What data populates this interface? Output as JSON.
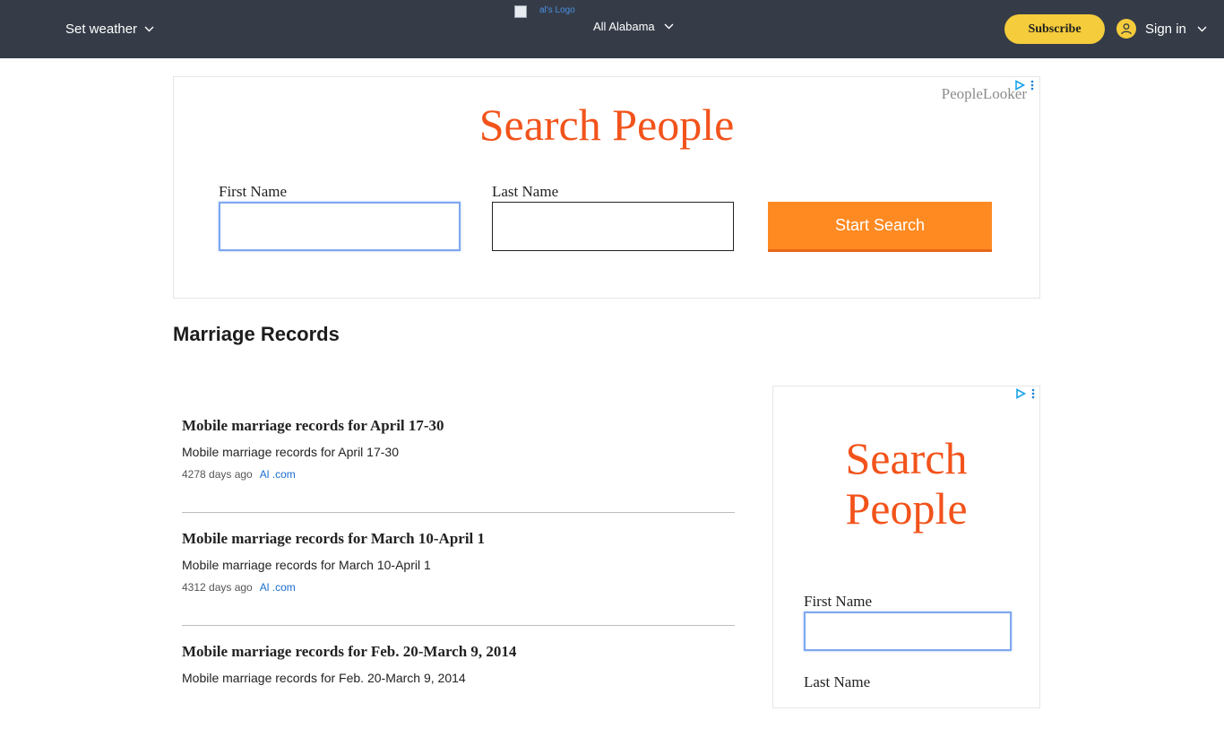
{
  "header": {
    "weather_label": "Set weather",
    "logo_alt": "al's Logo",
    "edition_label": "All Alabama",
    "subscribe_label": "Subscribe",
    "signin_label": "Sign in"
  },
  "ad_top": {
    "brand": "PeopleLooker",
    "title": "Search People",
    "first_name_label": "First Name",
    "first_name_value": "",
    "last_name_label": "Last Name",
    "last_name_value": "",
    "button_label": "Start Search"
  },
  "section": {
    "title": "Marriage Records"
  },
  "articles": [
    {
      "title": "Mobile marriage records for April 17-30",
      "summary": "Mobile marriage records for April 17-30",
      "age": "4278 days ago",
      "source": "Al .com"
    },
    {
      "title": "Mobile marriage records for March 10-April 1",
      "summary": "Mobile marriage records for March 10-April 1",
      "age": "4312 days ago",
      "source": "Al .com"
    },
    {
      "title": "Mobile marriage records for Feb. 20-March 9, 2014",
      "summary": "Mobile marriage records for Feb. 20-March 9, 2014",
      "age": "",
      "source": ""
    }
  ],
  "ad_side": {
    "title_line1": "Search",
    "title_line2": "People",
    "first_name_label": "First Name",
    "first_name_value": "",
    "last_name_label": "Last Name"
  },
  "colors": {
    "header_bg": "#353c48",
    "subscribe_bg": "#f5cc3b",
    "ad_title": "#f2531b",
    "button_bg": "#ff8a22",
    "link": "#1a6ccf"
  },
  "icons": [
    "chevron-down-icon",
    "user-icon",
    "adchoices-icon",
    "ad-menu-icon",
    "broken-image-icon"
  ]
}
